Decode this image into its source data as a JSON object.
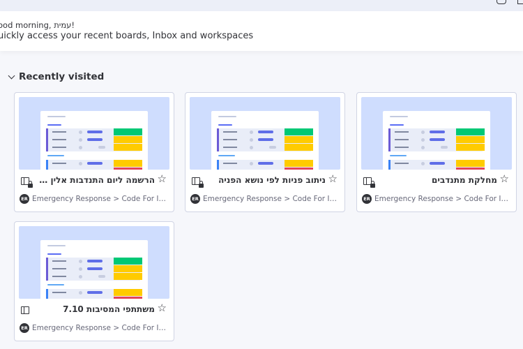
{
  "greeting": {
    "hello": "ood morning, עמית!",
    "subtitle": "uickly access your recent boards, Inbox and workspaces"
  },
  "section": {
    "title": "Recently visited",
    "icon": "chevron-down-icon"
  },
  "colors": {
    "done": "#00c875",
    "working": "#fdab3d",
    "yellow": "#ffcb00",
    "stuck": "#e2445c",
    "thumb_bg": "#cfddfe"
  },
  "boards": [
    {
      "name": "מחלקת מתנדבים",
      "workspace_badge": "ER",
      "path": "Emergency Response > Code For Israel ..."
    },
    {
      "name": "ניתוב פניות לפי נושא הפניה",
      "workspace_badge": "ER",
      "path": "Emergency Response > Code For Israel ..."
    },
    {
      "name": "הרשמה ליום התנדבות אלין בית לבין ...",
      "workspace_badge": "ER",
      "path": "Emergency Response > Code For Israel ..."
    },
    {
      "name": "משתתפי המסיבות 7.10",
      "workspace_badge": "ER",
      "path": "Emergency Response > Code For Israel ..."
    }
  ]
}
